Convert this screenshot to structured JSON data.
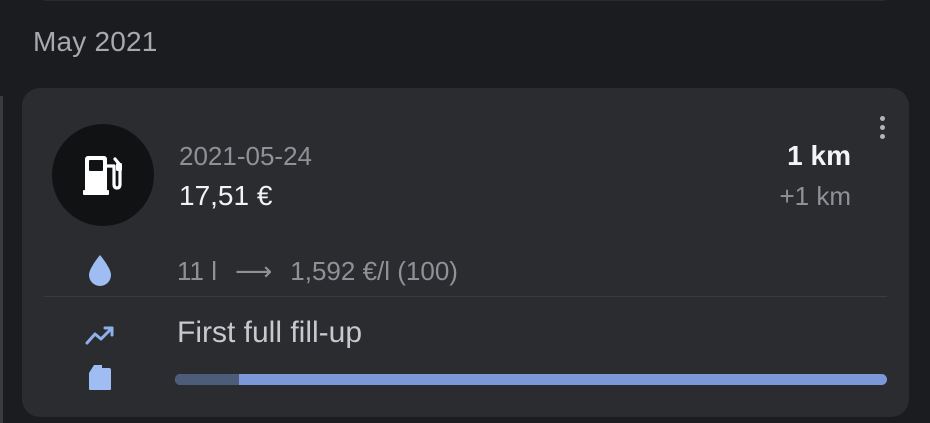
{
  "month_header": "May 2021",
  "entry": {
    "date": "2021-05-24",
    "cost": "17,51 €",
    "distance": "1 km",
    "distance_delta": "+1 km",
    "volume": "11 l",
    "arrow": "⟶",
    "price_per_liter": "1,592 €/l",
    "fuel_grade": "(100)",
    "fillup_title": "First full fill-up",
    "progress_fraction": 0.09,
    "icons": {
      "fuel_pump": "fuel-pump-icon",
      "drop": "drop-icon",
      "trend": "trend-icon",
      "jerrycan": "jerrycan-icon",
      "more": "more-vert-icon"
    },
    "colors": {
      "background": "#1b1c1f",
      "card": "#2b2c30",
      "accent": "#7d98d8",
      "progress_filled": "#4c5c79"
    }
  }
}
